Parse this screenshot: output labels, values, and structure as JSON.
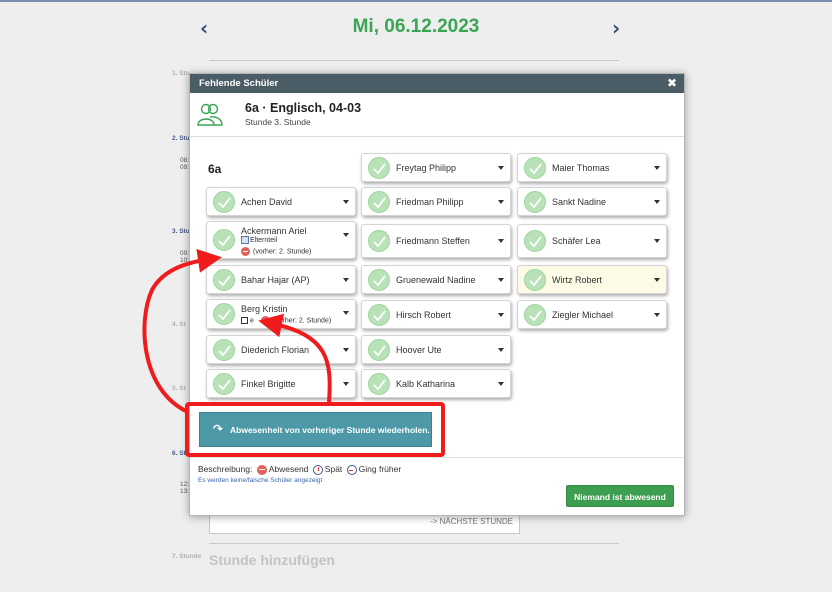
{
  "header": {
    "prev": "‹",
    "date": "Mi, 06.12.2023",
    "next": "›"
  },
  "background": {
    "lessons": [
      {
        "num": "1. Stu"
      },
      {
        "num": "2. Stu",
        "times": [
          "08:",
          "09:"
        ]
      },
      {
        "num": "3. Stu",
        "times": [
          "09:",
          "10:"
        ]
      },
      {
        "num": "4. St"
      },
      {
        "num": "5. St"
      },
      {
        "num": "6. Stu",
        "times": [
          "12:",
          "13:"
        ]
      },
      {
        "num": "7. Stunde"
      }
    ],
    "next_lesson": "-> NÄCHSTE STUNDE",
    "add_lesson": "Stunde hinzufügen"
  },
  "modal": {
    "title": "Fehlende Schüler",
    "close": "✖",
    "class_title": "6a · Englisch, 04-03",
    "class_subtitle": "Stunde 3. Stunde",
    "group": "6a",
    "students": [
      {
        "name": "Achen David"
      },
      {
        "name": "Ackermann Ariel",
        "note1": "Elternteil",
        "note2": "(vorher: 2. Stunde)"
      },
      {
        "name": "Bahar Hajar (AP)"
      },
      {
        "name": "Berg Kristin",
        "note1": "e",
        "note2": "(vorher: 2. Stunde)"
      },
      {
        "name": "Diederich Florian"
      },
      {
        "name": "Finkel Brigitte"
      },
      {
        "name": "Freytag Philipp"
      },
      {
        "name": "Friedman Philipp"
      },
      {
        "name": "Friedmann Steffen"
      },
      {
        "name": "Gruenewald Nadine"
      },
      {
        "name": "Hirsch Robert"
      },
      {
        "name": "Hoover Ute"
      },
      {
        "name": "Kalb Katharina"
      },
      {
        "name": "Maier Thomas"
      },
      {
        "name": "Sankt Nadine"
      },
      {
        "name": "Schäfer Lea"
      },
      {
        "name": "Wirtz Robert"
      },
      {
        "name": "Ziegler Michael"
      }
    ],
    "repeat_button": "Abwesenheit von vorheriger Stunde wiederholen.",
    "legend": {
      "label": "Beschreibung:",
      "absent": "Abwesend",
      "late": "Spät",
      "left_early": "Ging früher"
    },
    "hint": "Es werden keine/falsche Schüler angezeigt",
    "nobody_button": "Niemand ist abwesend"
  },
  "colors": {
    "date": "#3aa552",
    "header_bar": "#4a5d67",
    "repeat_button": "#4d99a8",
    "nobody_button": "#3e9e50",
    "annotation": "#ee1c1c",
    "check": "#b9e2b9"
  }
}
